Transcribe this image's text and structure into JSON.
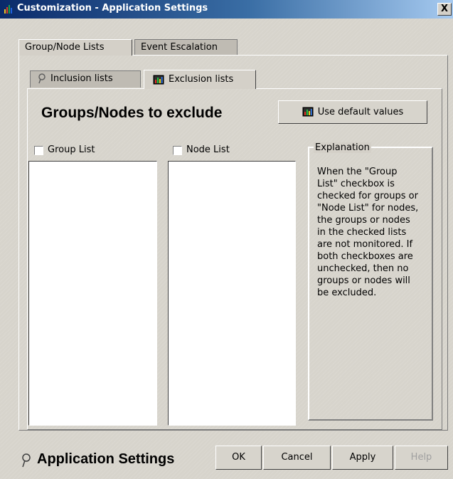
{
  "window": {
    "title": "Customization - Application Settings",
    "close_label": "X"
  },
  "tabs": {
    "primary": [
      "Group/Node Lists",
      "Event Escalation"
    ],
    "secondary": [
      "Inclusion lists",
      "Exclusion lists"
    ]
  },
  "panel": {
    "heading": "Groups/Nodes to exclude",
    "default_button": "Use default values",
    "group_list_label": "Group List",
    "node_list_label": "Node List",
    "group_list_checked": false,
    "node_list_checked": false,
    "explanation_title": "Explanation",
    "explanation_text": "When the \"Group List\" checkbox is checked for groups or \"Node List\" for nodes, the groups or nodes in the checked lists are not monitored.  If both checkboxes are unchecked, then no groups or nodes will be excluded."
  },
  "footer": {
    "title": "Application Settings",
    "buttons": {
      "ok": "OK",
      "cancel": "Cancel",
      "apply": "Apply",
      "help": "Help"
    }
  },
  "icons": {
    "app": "bar-chart-icon",
    "pin": "pushpin-icon",
    "exclusion": "monitor-chart-icon"
  },
  "colors": {
    "title_bar_start": "#0a2a6a",
    "title_bar_end": "#a6caf0",
    "dialog_bg": "#d4d0c8"
  }
}
